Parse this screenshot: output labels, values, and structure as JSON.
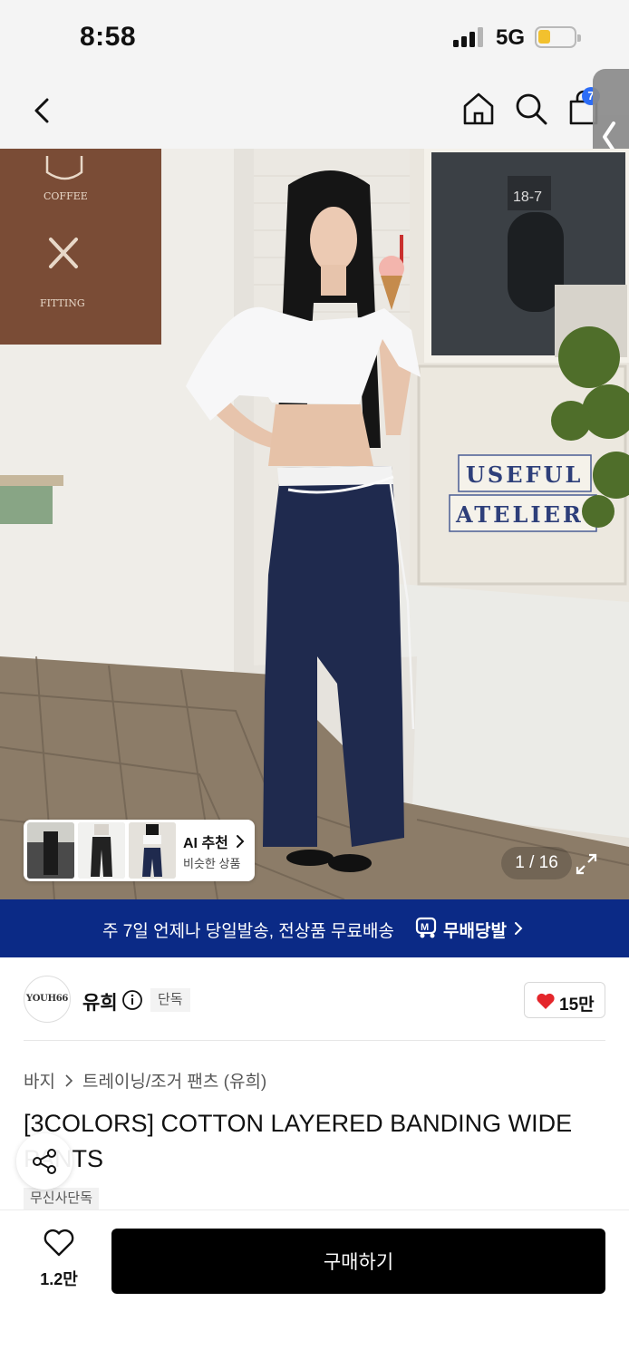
{
  "status_bar": {
    "time": "8:58",
    "network": "5G"
  },
  "nav": {
    "cart_badge": "7"
  },
  "hero": {
    "thumbnails": {
      "title": "AI 추천",
      "subtitle": "비슷한 상품"
    },
    "page_counter": "1 / 16",
    "signs": [
      "COFFEE",
      "FITTING",
      "USEFUL",
      "ATELIER",
      "18-7"
    ]
  },
  "promo": {
    "text": "주 7일 언제나 당일발송, 전상품 무료배송",
    "brand": "무배당발"
  },
  "brand": {
    "logo_text": "YOUH66",
    "name": "유희",
    "badge": "단독",
    "like_count": "15만"
  },
  "breadcrumb": {
    "level1": "바지",
    "level2": "트레이닝/조거 팬츠 (유희)"
  },
  "product": {
    "title": "[3COLORS] COTTON LAYERED BANDING WIDE PANTS",
    "tag": "무신사단독"
  },
  "bottom_bar": {
    "wish_count": "1.2만",
    "buy_label": "구매하기"
  },
  "colors": {
    "promo_bg": "#0b2a86",
    "buy_bg": "#000000",
    "heart": "#e4262b",
    "badge": "#2c6cf6"
  }
}
